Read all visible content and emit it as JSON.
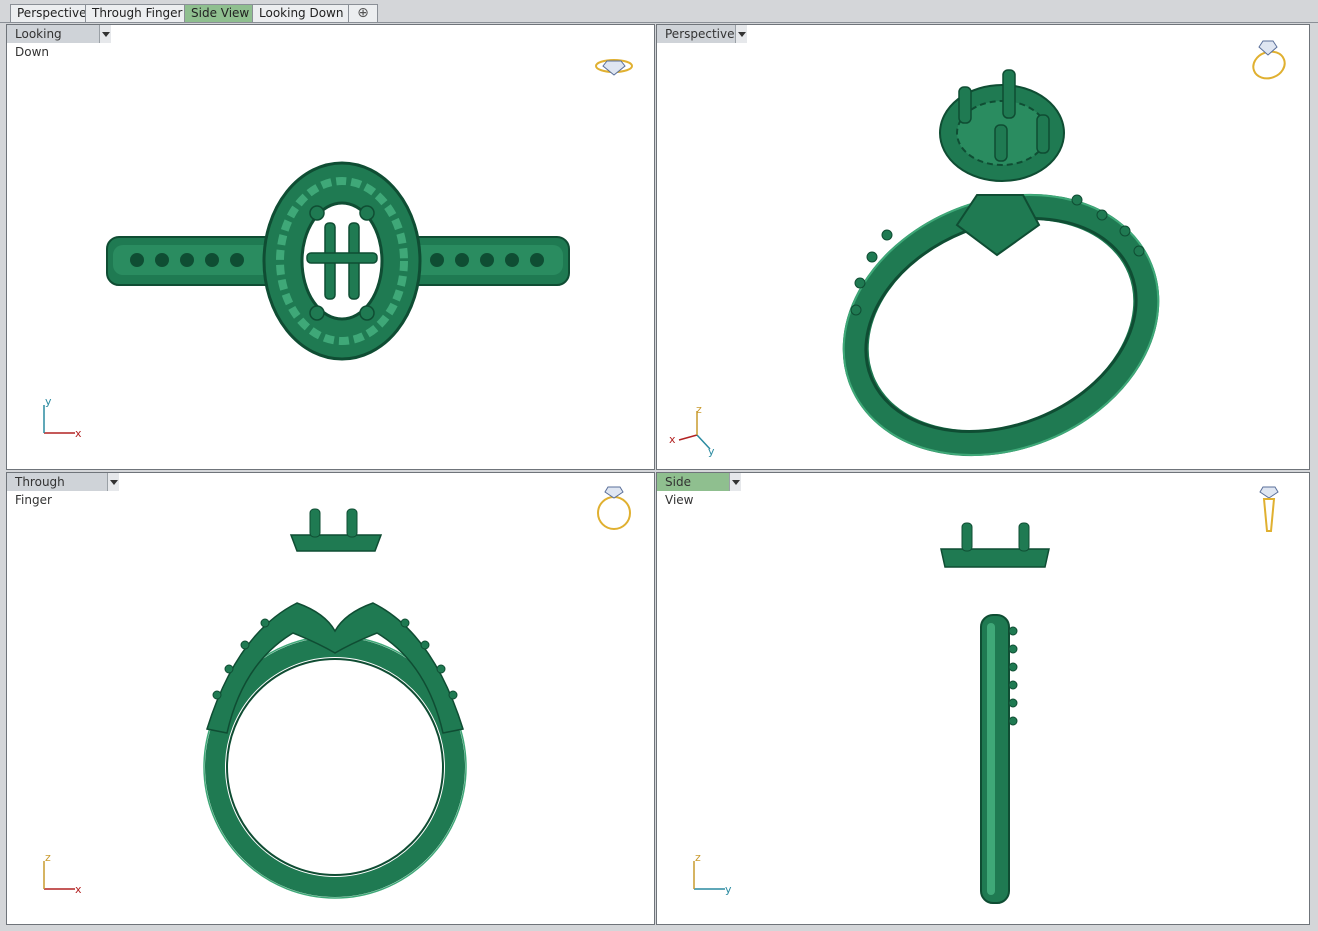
{
  "tabs": [
    {
      "label": "Perspective"
    },
    {
      "label": "Through Finger"
    },
    {
      "label": "Side View"
    },
    {
      "label": "Looking Down"
    }
  ],
  "active_tab": "Side View",
  "add_tab_icon": "plus-icon",
  "viewports": [
    {
      "label": "Looking Down",
      "axes": {
        "h": "x",
        "v": "y"
      },
      "icon": "ring-top-icon"
    },
    {
      "label": "Perspective",
      "axes": {
        "x": "x",
        "y": "y",
        "z": "z"
      },
      "icon": "ring-perspective-icon"
    },
    {
      "label": "Through Finger",
      "axes": {
        "h": "x",
        "v": "z"
      },
      "icon": "ring-front-icon"
    },
    {
      "label": "Side View",
      "axes": {
        "h": "y",
        "v": "z"
      },
      "icon": "ring-side-icon"
    }
  ],
  "colors": {
    "model_green": "#1f7a52",
    "model_dark": "#0f4d33",
    "model_light": "#3fa878",
    "active_green": "#8fbf8f",
    "axis_x": "#b22222",
    "axis_y": "#2a8aa0",
    "axis_z": "#c99a2e",
    "icon_gold": "#e0b030"
  }
}
